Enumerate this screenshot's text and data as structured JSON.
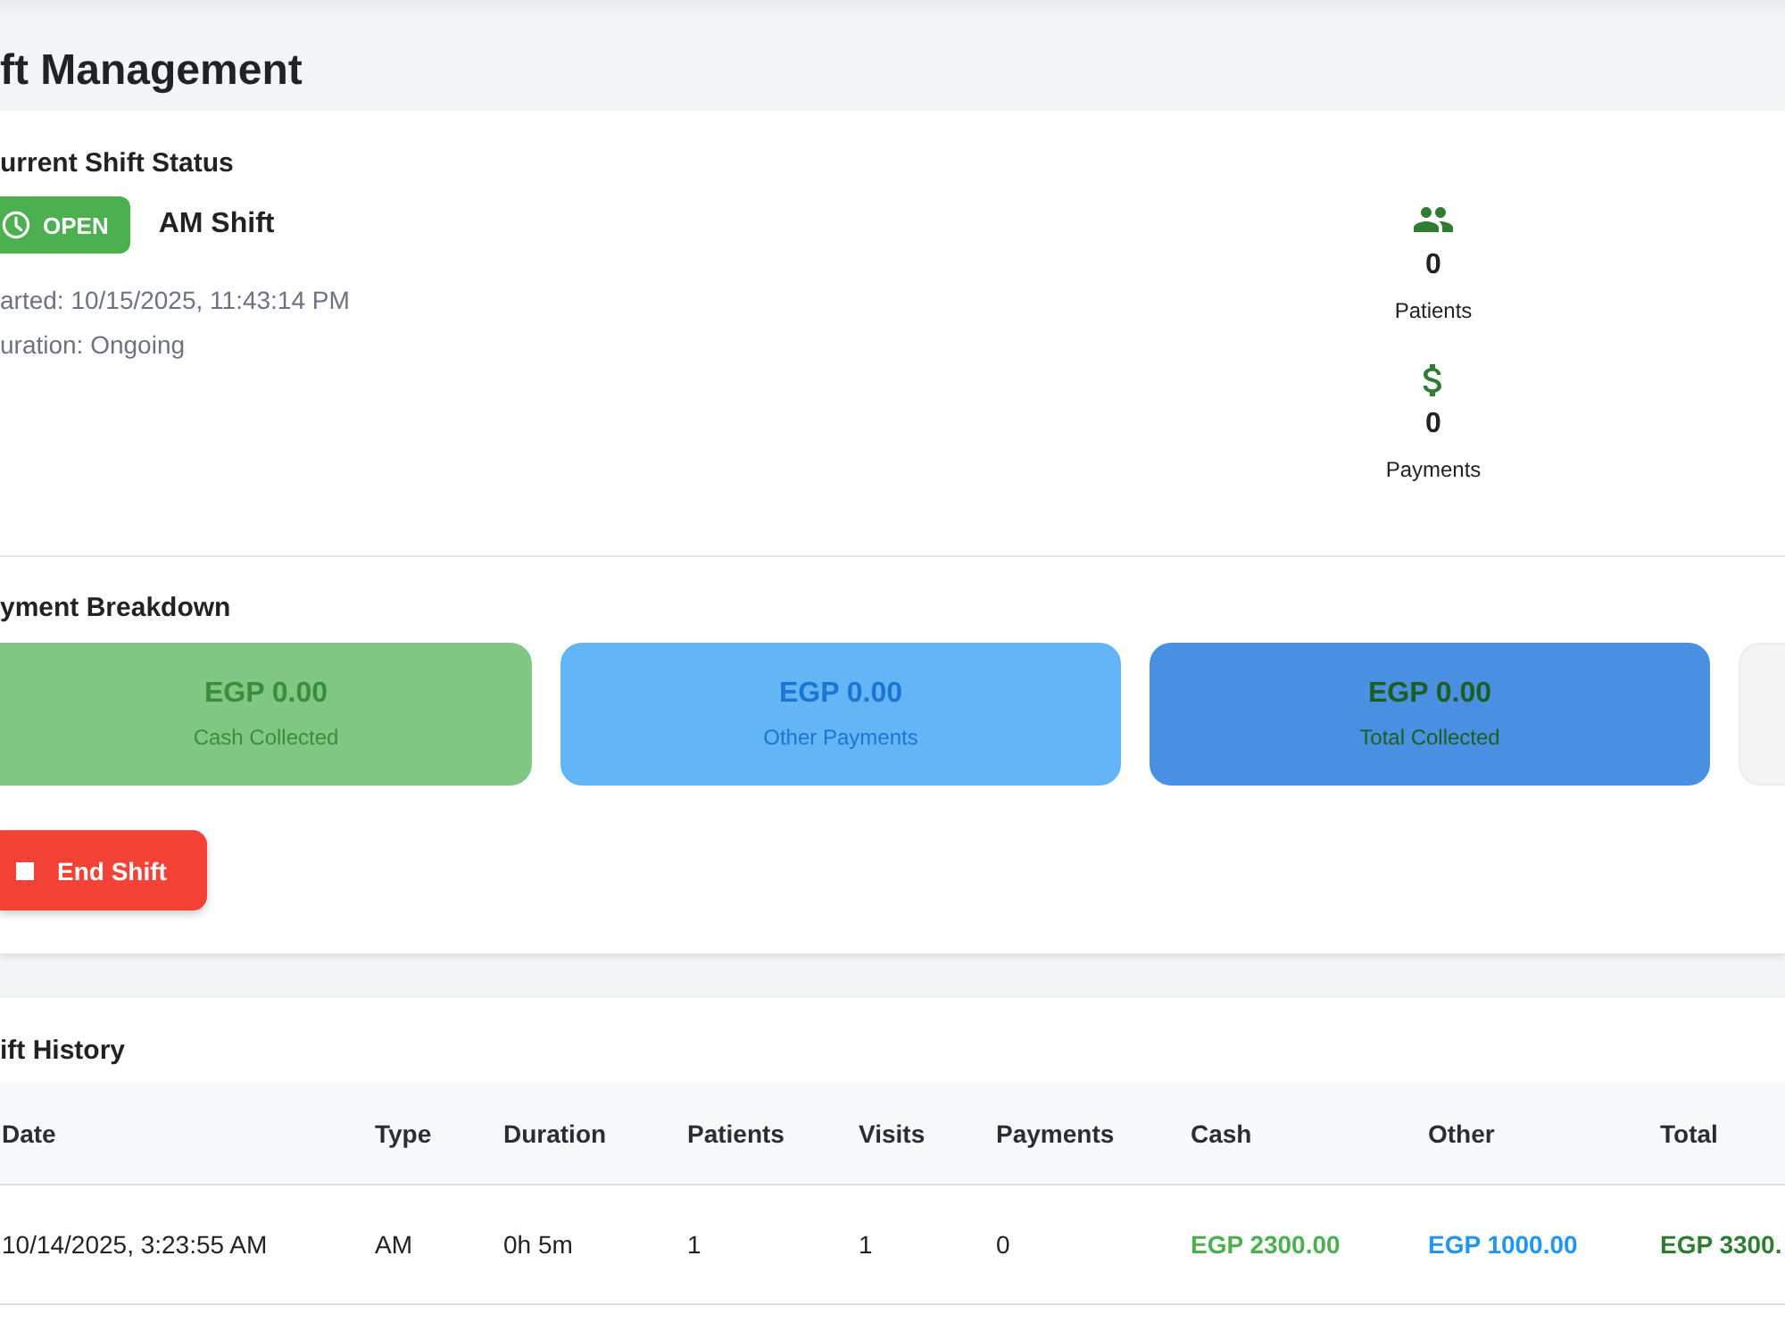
{
  "page": {
    "title": "ft Management"
  },
  "current_shift": {
    "title": "urrent Shift Status",
    "status": {
      "label": "OPEN",
      "open": true
    },
    "shift_name": "AM Shift",
    "details": [
      "arted: 10/15/2025, 11:43:14 PM",
      "uration: Ongoing"
    ],
    "stats": [
      {
        "kind": "patients",
        "value": "0",
        "label": "Patients"
      },
      {
        "kind": "payments",
        "value": "0",
        "label": "Payments"
      }
    ]
  },
  "payment_breakdown": {
    "title": "yment Breakdown",
    "cards": [
      {
        "kind": "cash",
        "amount": "EGP 0.00",
        "label": "Cash Collected"
      },
      {
        "kind": "other",
        "amount": "EGP 0.00",
        "label": "Other Payments"
      },
      {
        "kind": "total",
        "amount": "EGP 0.00",
        "label": "Total Collected"
      },
      {
        "kind": "blank"
      }
    ]
  },
  "end_shift_button": {
    "label": "End Shift"
  },
  "shift_history": {
    "title": "ift History",
    "columns": [
      "Date",
      "Type",
      "Duration",
      "Patients",
      "Visits",
      "Payments",
      "Cash",
      "Other",
      "Total"
    ],
    "rows": [
      {
        "cells": [
          {
            "kind": "text",
            "text": "10/14/2025, 3:23:55 AM"
          },
          {
            "kind": "text",
            "text": "AM"
          },
          {
            "kind": "text",
            "text": "0h 5m"
          },
          {
            "kind": "text",
            "text": "1"
          },
          {
            "kind": "text",
            "text": "1"
          },
          {
            "kind": "text",
            "text": "0"
          },
          {
            "kind": "cash",
            "text": "EGP 2300.00"
          },
          {
            "kind": "other",
            "text": "EGP 1000.00"
          },
          {
            "kind": "total",
            "text": "EGP 3300."
          }
        ]
      }
    ]
  }
}
